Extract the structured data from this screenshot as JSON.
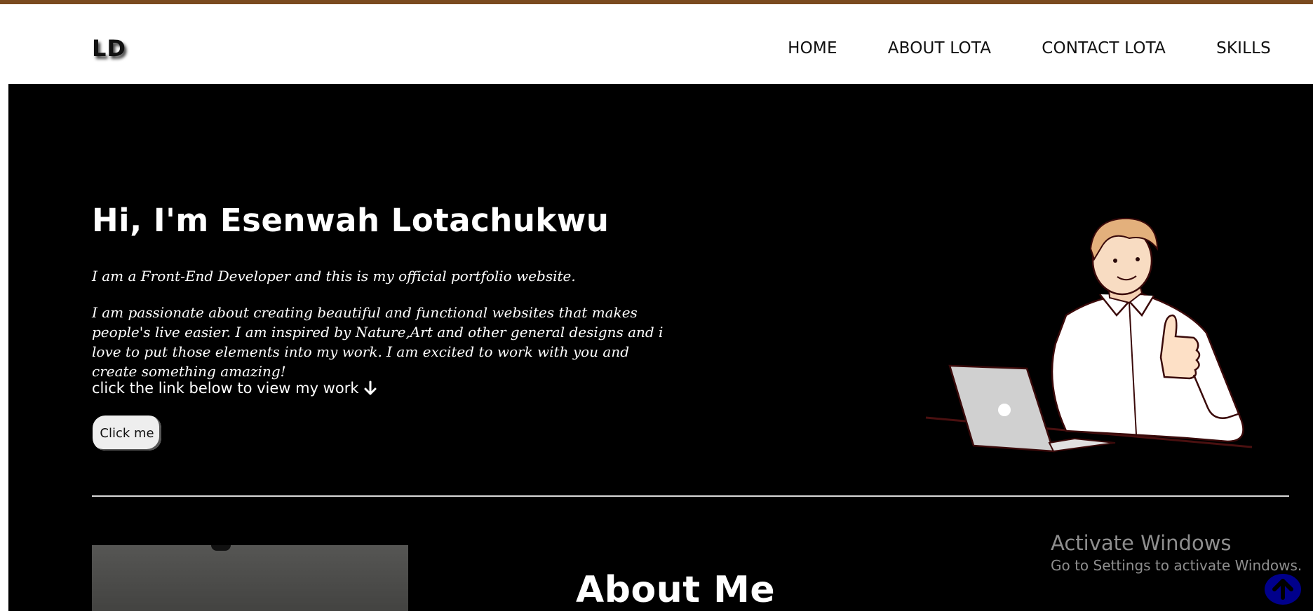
{
  "brand": {
    "logo": "LD"
  },
  "nav": {
    "items": [
      {
        "label": "HOME",
        "name": "nav-home"
      },
      {
        "label": "ABOUT LOTA",
        "name": "nav-about"
      },
      {
        "label": "CONTACT LOTA",
        "name": "nav-contact"
      },
      {
        "label": "SKILLS",
        "name": "nav-skills"
      }
    ]
  },
  "hero": {
    "title": "Hi, I'm Esenwah Lotachukwu",
    "intro": "I am a Front-End Developer and this is my official portfolio website.",
    "description": "I am passionate about creating beautiful and functional websites that makes people's live easier. I am inspired by Nature,Art and other general designs and i love to put those elements into my work. I am excited to work with you and create something amazing!",
    "cta_text": "click the link below to view my work",
    "cta_icon": "arrow-down-icon",
    "button_label": "Click me",
    "illustration": "man-laptop-thumbs-up-illustration"
  },
  "about": {
    "title": "About Me"
  },
  "watermark": {
    "line1": "Activate Windows",
    "line2": "Go to Settings to activate Windows."
  },
  "scroll_top": {
    "icon": "arrow-up-circle-icon"
  },
  "colors": {
    "topbar": "#7a4a1f",
    "hero_bg": "#000000",
    "scroll_button": "#00008b"
  }
}
